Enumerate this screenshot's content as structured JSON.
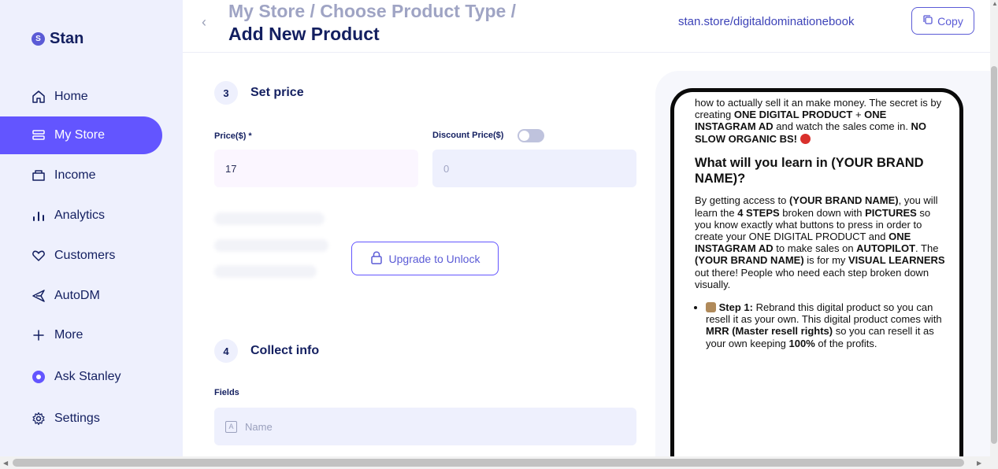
{
  "sidebar": {
    "logo_text": "Stan",
    "logo_mark": "S",
    "items": [
      {
        "label": "Home",
        "icon": "home-icon"
      },
      {
        "label": "My Store",
        "icon": "store-icon",
        "active": true
      },
      {
        "label": "Income",
        "icon": "wallet-icon"
      },
      {
        "label": "Analytics",
        "icon": "bar-chart-icon"
      },
      {
        "label": "Customers",
        "icon": "heart-icon"
      },
      {
        "label": "AutoDM",
        "icon": "send-icon"
      },
      {
        "label": "More",
        "icon": "plus-icon"
      },
      {
        "label": "Ask Stanley",
        "icon": "stanley-icon"
      },
      {
        "label": "Settings",
        "icon": "gear-icon"
      }
    ]
  },
  "header": {
    "breadcrumb": "My Store / Choose Product Type /",
    "title": "Add New Product",
    "store_url": "stan.store/digitaldominationebook",
    "copy_label": "Copy"
  },
  "price_section": {
    "step": "3",
    "title": "Set price",
    "price_label": "Price($) *",
    "price_value": "17",
    "discount_label": "Discount Price($)",
    "discount_value": "0",
    "unlock_label": "Upgrade to Unlock"
  },
  "collect_section": {
    "step": "4",
    "title": "Collect info",
    "fields_label": "Fields",
    "name_placeholder": "Name",
    "name_icon_glyph": "A"
  },
  "colors": {
    "accent": "#6355ff",
    "sidebar_bg": "#eef0fd",
    "text_dark": "#131f60"
  }
}
